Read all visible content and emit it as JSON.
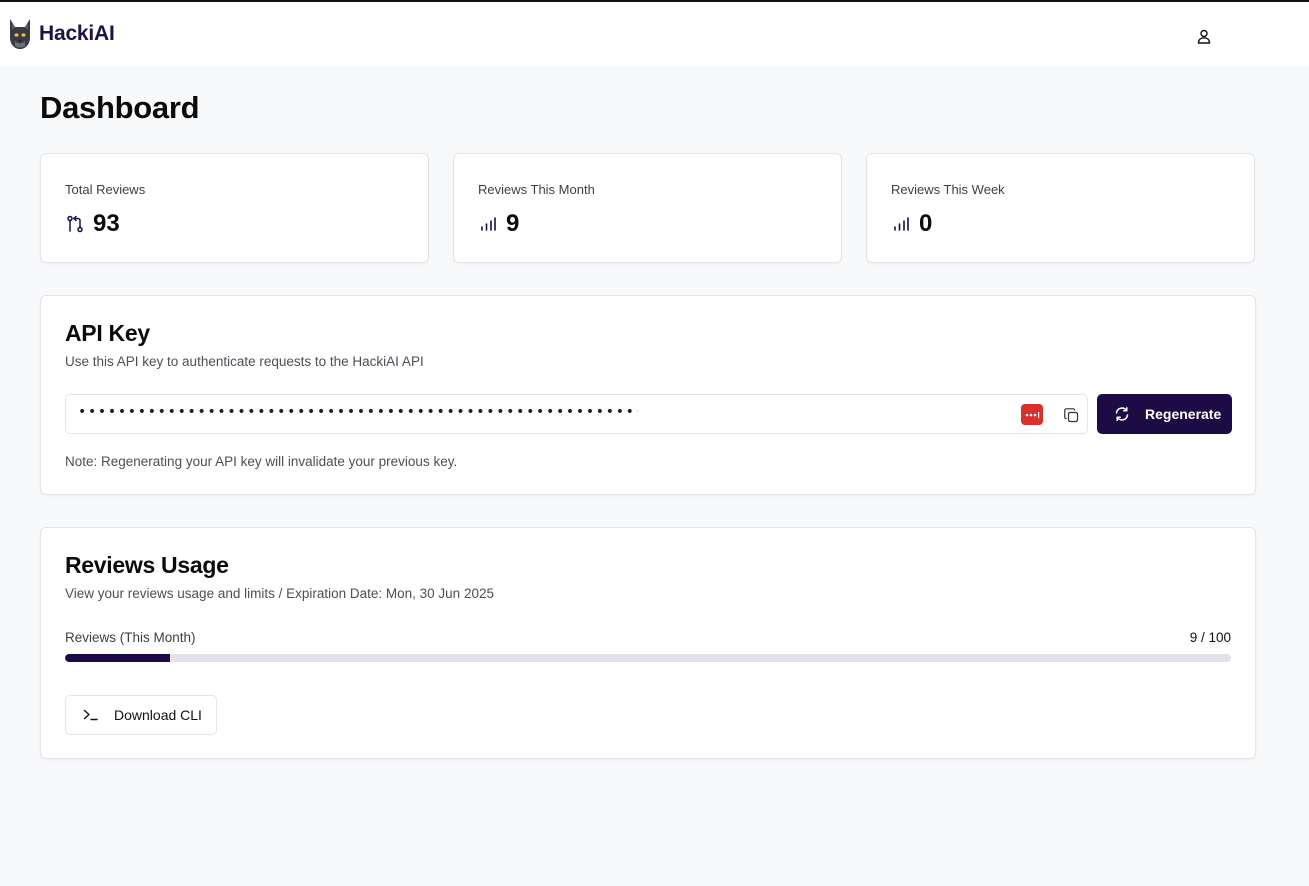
{
  "brand": {
    "name": "HackiAI",
    "logo_icon": "fox-mascot-icon"
  },
  "header": {
    "user_icon": "user-icon"
  },
  "page": {
    "title": "Dashboard"
  },
  "stats": [
    {
      "label": "Total Reviews",
      "value": "93",
      "icon": "git-pull-request-icon"
    },
    {
      "label": "Reviews This Month",
      "value": "9",
      "icon": "bar-chart-icon"
    },
    {
      "label": "Reviews This Week",
      "value": "0",
      "icon": "bar-chart-icon"
    }
  ],
  "api_key": {
    "title": "API Key",
    "subtitle": "Use this API key to authenticate requests to the HackiAI API",
    "masked_value": "••••••••••••••••••••••••••••••••••••••••••••••••••••••••••••••",
    "regenerate_label": "Regenerate",
    "note": "Note: Regenerating your API key will invalidate your previous key."
  },
  "usage": {
    "title": "Reviews Usage",
    "subtitle": "View your reviews usage and limits / Expiration Date: Mon, 30 Jun 2025",
    "label": "Reviews (This Month)",
    "count_text": "9 / 100",
    "used": 9,
    "limit": 100,
    "download_label": "Download CLI"
  },
  "colors": {
    "accent": "#1d0b45",
    "password_manager": "#d8302b"
  }
}
